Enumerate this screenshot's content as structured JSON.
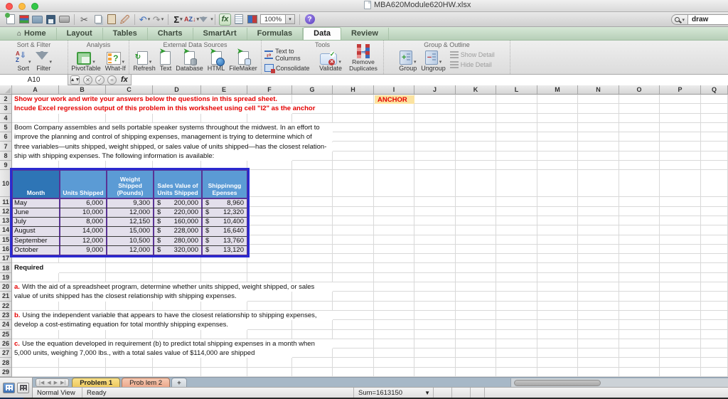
{
  "window": {
    "title": "MBA620Module620HW.xlsx",
    "search_value": "draw",
    "zoom_level": "100%"
  },
  "ribbon": {
    "tabs": [
      "Home",
      "Layout",
      "Tables",
      "Charts",
      "SmartArt",
      "Formulas",
      "Data",
      "Review"
    ],
    "active_tab": "Data",
    "groups": [
      {
        "label": "Sort & Filter",
        "buttons": [
          "Sort",
          "Filter"
        ]
      },
      {
        "label": "Analysis",
        "buttons": [
          "PivotTable",
          "What-If"
        ]
      },
      {
        "label": "External Data Sources",
        "buttons": [
          "Refresh",
          "Text",
          "Database",
          "HTML",
          "FileMaker"
        ]
      },
      {
        "label": "Tools",
        "buttons": [
          "Text to Columns",
          "Consolidate",
          "Validate",
          "Remove Duplicates"
        ]
      },
      {
        "label": "Group & Outline",
        "buttons": [
          "Group",
          "Ungroup",
          "Show Detail",
          "Hide Detail"
        ]
      }
    ]
  },
  "formula_bar": {
    "name_box": "A10"
  },
  "grid": {
    "columns": [
      "A",
      "B",
      "C",
      "D",
      "E",
      "F",
      "G",
      "H",
      "I",
      "J",
      "K",
      "L",
      "M",
      "N",
      "O",
      "P",
      "Q"
    ],
    "rows": [
      "2",
      "3",
      "4",
      "5",
      "6",
      "7",
      "8",
      "9",
      "10",
      "11",
      "12",
      "13",
      "14",
      "15",
      "16",
      "17",
      "18",
      "19",
      "20",
      "21",
      "22",
      "23",
      "24",
      "25",
      "26",
      "27",
      "28",
      "29"
    ]
  },
  "notes": {
    "line1": "Show your work and write your answers below the questions in this spread sheet.",
    "line2": "Incude Excel regression output of this problem in this worksheet using cell \"I2\" as the anchor",
    "anchor_label": "ANCHOR"
  },
  "intro": [
    "Boom Company assembles and sells portable speaker systems throughout the midwest. In an effort to",
    "improve the planning and control of shipping expenses, management is trying to determine which of",
    "three variables—units shipped, weight shipped, or sales value of units shipped—has the closest relation-",
    "ship with shipping expenses. The following information is available:"
  ],
  "table": {
    "currency": "$",
    "headers": [
      "Month",
      "Units Shipped",
      "Weight Shipped (Pounds)",
      "Sales Value of Units Shipped",
      "Shippinngg Epenses"
    ],
    "rows": [
      {
        "month": "May",
        "units": "6,000",
        "weight": "9,300",
        "sales": "200,000",
        "shipping": "8,960"
      },
      {
        "month": "June",
        "units": "10,000",
        "weight": "12,000",
        "sales": "220,000",
        "shipping": "12,320"
      },
      {
        "month": "July",
        "units": "8,000",
        "weight": "12,150",
        "sales": "160,000",
        "shipping": "10,400"
      },
      {
        "month": "August",
        "units": "14,000",
        "weight": "15,000",
        "sales": "228,000",
        "shipping": "16,640"
      },
      {
        "month": "September",
        "units": "12,000",
        "weight": "10,500",
        "sales": "280,000",
        "shipping": "13,760"
      },
      {
        "month": "October",
        "units": "9,000",
        "weight": "12,000",
        "sales": "320,000",
        "shipping": "13,120"
      }
    ]
  },
  "required_label": "Required",
  "questions": [
    {
      "prefix": "a.",
      "lines": [
        "With the aid of a spreadsheet program, determine whether units shipped, weight shipped, or sales",
        "value of units shipped has the closest relationship with shipping expenses."
      ]
    },
    {
      "prefix": "b.",
      "lines": [
        "Using the independent variable that appears to have the closest relationship to shipping expenses,",
        "develop a cost-estimating equation for total monthly shipping expenses."
      ]
    },
    {
      "prefix": "c.",
      "lines": [
        "Use the equation developed in requirement (b) to predict total shipping expenses in a month when",
        "5,000 units, weighing 7,000 lbs., with a total sales value of $114,000 are shipped"
      ]
    }
  ],
  "sheet_tabs": {
    "tabs": [
      "Problem 1",
      "Prob lem 2"
    ],
    "active": "Problem 1",
    "add_label": "+"
  },
  "status_bar": {
    "view": "Normal View",
    "status": "Ready",
    "sum": "Sum=1613150"
  },
  "colors": {
    "table_header_dark": "#2e75b6",
    "table_header_light": "#5b9bd5",
    "table_row_bg": "#e3dfeb",
    "table_border_outer": "#2a2ad0",
    "table_border_inner": "#5a3294",
    "note_red": "#e50000",
    "anchor_bg": "#fbe3a0",
    "tab_active_yellow": "#f2d06b",
    "tab_salmon": "#f2b9a0",
    "ribbon_green": "#cfe2cf"
  }
}
